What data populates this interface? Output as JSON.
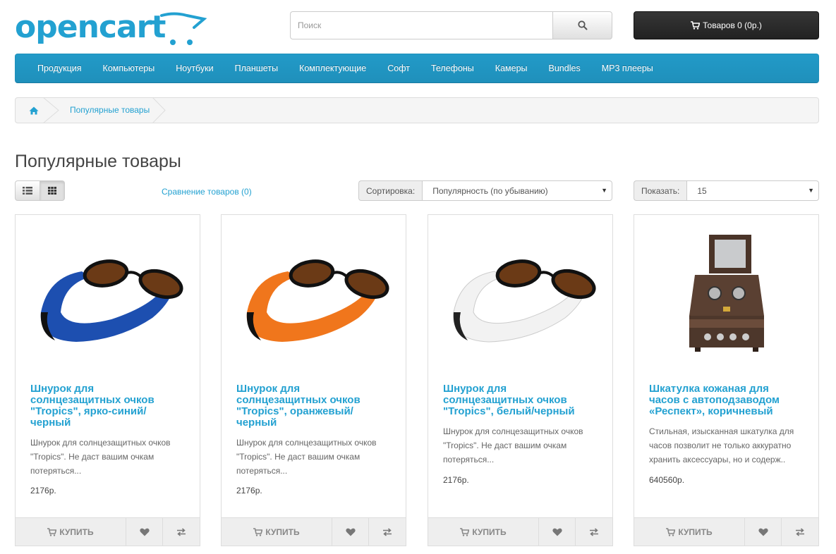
{
  "header": {
    "logo_text": "opencart",
    "search": {
      "placeholder": "Поиск"
    },
    "cart_label": "Товаров 0 (0р.)"
  },
  "menu": {
    "items": [
      {
        "label": "Продукция"
      },
      {
        "label": "Компьютеры"
      },
      {
        "label": "Ноутбуки"
      },
      {
        "label": "Планшеты"
      },
      {
        "label": "Комплектующие"
      },
      {
        "label": "Софт"
      },
      {
        "label": "Телефоны"
      },
      {
        "label": "Камеры"
      },
      {
        "label": "Bundles"
      },
      {
        "label": "MP3 плееры"
      }
    ]
  },
  "breadcrumb": {
    "current": "Популярные товары",
    "home_icon": "home-icon"
  },
  "page": {
    "title": "Популярные товары"
  },
  "toolbar": {
    "compare_link": "Сравнение товаров (0)",
    "sort_label": "Сортировка:",
    "sort_value": "Популярность (по убыванию)",
    "limit_label": "Показать:",
    "limit_value": "15"
  },
  "colors": {
    "accent": "#23a1d1",
    "menu_bg": "#229ac8",
    "cart_bg": "#303030",
    "strap_blue": "#1d4fb0",
    "strap_orange": "#f0761c",
    "strap_white": "#f2f2f2",
    "box_brown": "#5a4032"
  },
  "products": [
    {
      "name": "Шнурок для солнцезащитных очков \"Tropics\", ярко-синий/черный",
      "description": "Шнурок для солнцезащитных очков \"Tropics\". Не даст вашим очкам потеряться...",
      "price": "2176р.",
      "image": "blue-sunglasses-strap",
      "cart_label": "КУПИТЬ"
    },
    {
      "name": "Шнурок для солнцезащитных очков \"Tropics\", оранжевый/черный",
      "description": "Шнурок для солнцезащитных очков \"Tropics\". Не даст вашим очкам потеряться...",
      "price": "2176р.",
      "image": "orange-sunglasses-strap",
      "cart_label": "КУПИТЬ"
    },
    {
      "name": "Шнурок для солнцезащитных очков \"Tropics\", белый/черный",
      "description": "Шнурок для солнцезащитных очков \"Tropics\". Не даст вашим очкам потеряться...",
      "price": "2176р.",
      "image": "white-sunglasses-strap",
      "cart_label": "КУПИТЬ"
    },
    {
      "name": "Шкатулка кожаная для часов с автоподзаводом «Респект», коричневый",
      "description": "Стильная, изысканная шкатулка для часов позволит не только аккуратно хранить аксессуары, но и содерж..",
      "price": "640560р.",
      "image": "watch-winder-box",
      "cart_label": "КУПИТЬ"
    }
  ]
}
